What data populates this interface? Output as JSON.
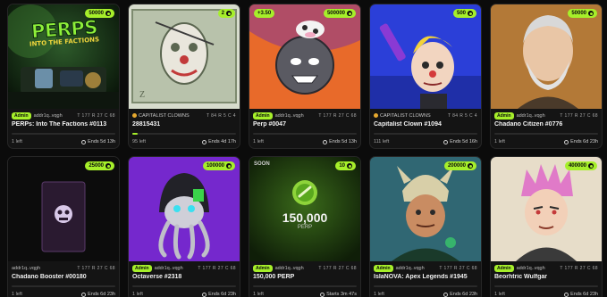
{
  "cards": [
    {
      "price": "50000",
      "tag": "",
      "admin": "Admin",
      "owner": "addr1q..vqgh",
      "rarity": "T 177  R 27  C 68",
      "title": "PERPs: Into The Factions #0113",
      "left": "1 left",
      "ends": "Ends 5d 13h",
      "progress": 0,
      "art_text": "PERPS",
      "art_sub": "INTO THE FACTIONS"
    },
    {
      "price": "2",
      "tag": "",
      "admin": "",
      "owner": "CAPITALIST CLOWNS",
      "rarity": "T 84  R 5  C 4",
      "title": "28815431",
      "left": "95 left",
      "ends": "Ends 4d 17h",
      "progress": 0.05,
      "art_text": "",
      "art_sub": ""
    },
    {
      "price": "500000",
      "tag": "+3.50",
      "admin": "Admin",
      "owner": "addr1q..vqgh",
      "rarity": "T 177  R 27  C 68",
      "title": "Perp #0047",
      "left": "1 left",
      "ends": "Ends 5d 13h",
      "progress": 0,
      "art_text": "",
      "art_sub": ""
    },
    {
      "price": "500",
      "tag": "",
      "admin": "",
      "owner": "CAPITALIST CLOWNS",
      "rarity": "T 84  R 5  C 4",
      "title": "Capitalist Clown #1094",
      "left": "111 left",
      "ends": "Ends 5d 16h",
      "progress": 0,
      "art_text": "",
      "art_sub": ""
    },
    {
      "price": "50000",
      "tag": "",
      "admin": "Admin",
      "owner": "addr1q..vqgh",
      "rarity": "T 177  R 27  C 68",
      "title": "Chadano Citizen #0776",
      "left": "1 left",
      "ends": "Ends 6d 23h",
      "progress": 0,
      "art_text": "",
      "art_sub": ""
    },
    {
      "price": "25000",
      "tag": "",
      "admin": "",
      "owner": "addr1q..vqgh",
      "rarity": "T 177  R 27  C 68",
      "title": "Chadano Booster #00180",
      "left": "1 left",
      "ends": "Ends 6d 23h",
      "progress": 0,
      "art_text": "",
      "art_sub": ""
    },
    {
      "price": "100000",
      "tag": "",
      "admin": "Admin",
      "owner": "addr1q..vqgh",
      "rarity": "T 177  R 27  C 68",
      "title": "Octaverse #2318",
      "left": "1 left",
      "ends": "Ends 6d 23h",
      "progress": 0,
      "art_text": "",
      "art_sub": ""
    },
    {
      "price": "10",
      "tag": "SOON",
      "admin": "Admin",
      "owner": "addr1q..vqgh",
      "rarity": "T 177  R 27  C 68",
      "title": "150,000 PERP",
      "left": "1 left",
      "ends": "Starts 3m 47s",
      "progress": 0,
      "art_text": "150,000",
      "art_sub": "PERP"
    },
    {
      "price": "200000",
      "tag": "",
      "admin": "Admin",
      "owner": "addr1q..vqgh",
      "rarity": "T 177  R 27  C 68",
      "title": "IsIaNOVA: Apex Legends #1945",
      "left": "1 left",
      "ends": "Ends 6d 23h",
      "progress": 0,
      "art_text": "",
      "art_sub": ""
    },
    {
      "price": "400000",
      "tag": "",
      "admin": "Admin",
      "owner": "addr1q..vqgh",
      "rarity": "T 177  R 27  C 68",
      "title": "Beorhtric Wulfgar",
      "left": "1 left",
      "ends": "Ends 6d 23h",
      "progress": 0,
      "art_text": "",
      "art_sub": ""
    }
  ],
  "colors": {
    "accent": "#a6ef2a",
    "background": "#0b0b0b",
    "card": "#141414"
  }
}
